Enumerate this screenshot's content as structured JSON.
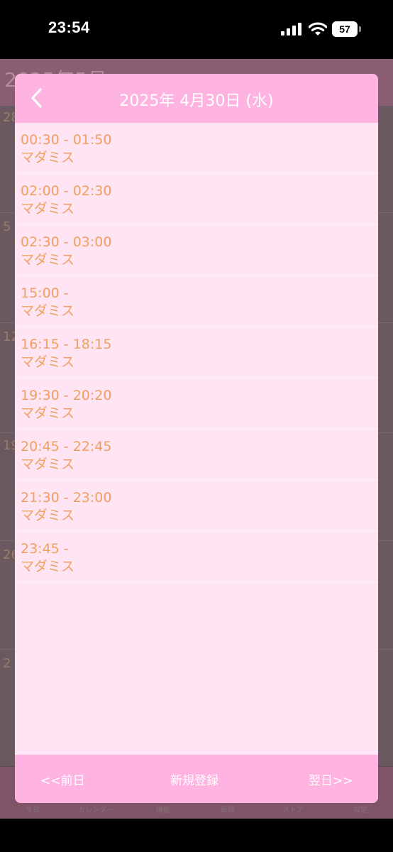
{
  "status_bar": {
    "time": "23:54",
    "battery_level": "57",
    "icons": [
      "signal-icon",
      "wifi-icon",
      "battery-icon"
    ]
  },
  "background": {
    "month_title": "2025年5月",
    "day_numbers": [
      "28",
      "5",
      "12",
      "19",
      "26",
      "2"
    ],
    "tabs": [
      "今日",
      "カレンダー",
      "機能",
      "新規",
      "ストア",
      "設定"
    ]
  },
  "modal": {
    "title": "2025年 4月30日 (水)",
    "back_icon": "chevron-left-icon",
    "events": [
      {
        "time": "00:30 - 01:50",
        "title": "マダミス"
      },
      {
        "time": "02:00 - 02:30",
        "title": "マダミス"
      },
      {
        "time": "02:30 - 03:00",
        "title": "マダミス"
      },
      {
        "time": "15:00 -",
        "title": "マダミス"
      },
      {
        "time": "16:15 - 18:15",
        "title": "マダミス"
      },
      {
        "time": "19:30 - 20:20",
        "title": "マダミス"
      },
      {
        "time": "20:45 - 22:45",
        "title": "マダミス"
      },
      {
        "time": "21:30 - 23:00",
        "title": "マダミス"
      },
      {
        "time": "23:45 -",
        "title": "マダミス"
      }
    ],
    "footer": {
      "prev_label": "<<前日",
      "new_label": "新規登録",
      "next_label": "翌日>>"
    }
  },
  "colors": {
    "header_pink": "#ffb3e0",
    "body_pink": "#ffe4f3",
    "event_text": "#f0a060"
  }
}
